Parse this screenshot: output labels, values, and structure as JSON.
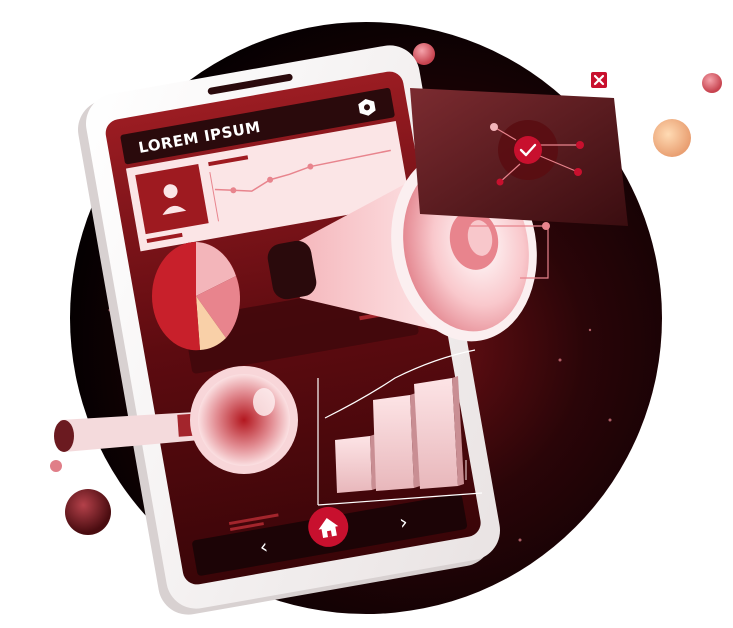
{
  "phone": {
    "header_title": "LOREM IPSUM"
  },
  "icons": {
    "close": "close-icon",
    "check": "check-icon",
    "home": "home-icon",
    "back": "chevron-left-icon",
    "forward": "chevron-right-icon",
    "settings": "hexagon-gear-icon",
    "profile": "user-icon"
  },
  "colors": {
    "brand_red": "#c8102e",
    "dark": "#1a0508",
    "accent_pink": "#e8848d",
    "panel": "#5a1d22"
  }
}
